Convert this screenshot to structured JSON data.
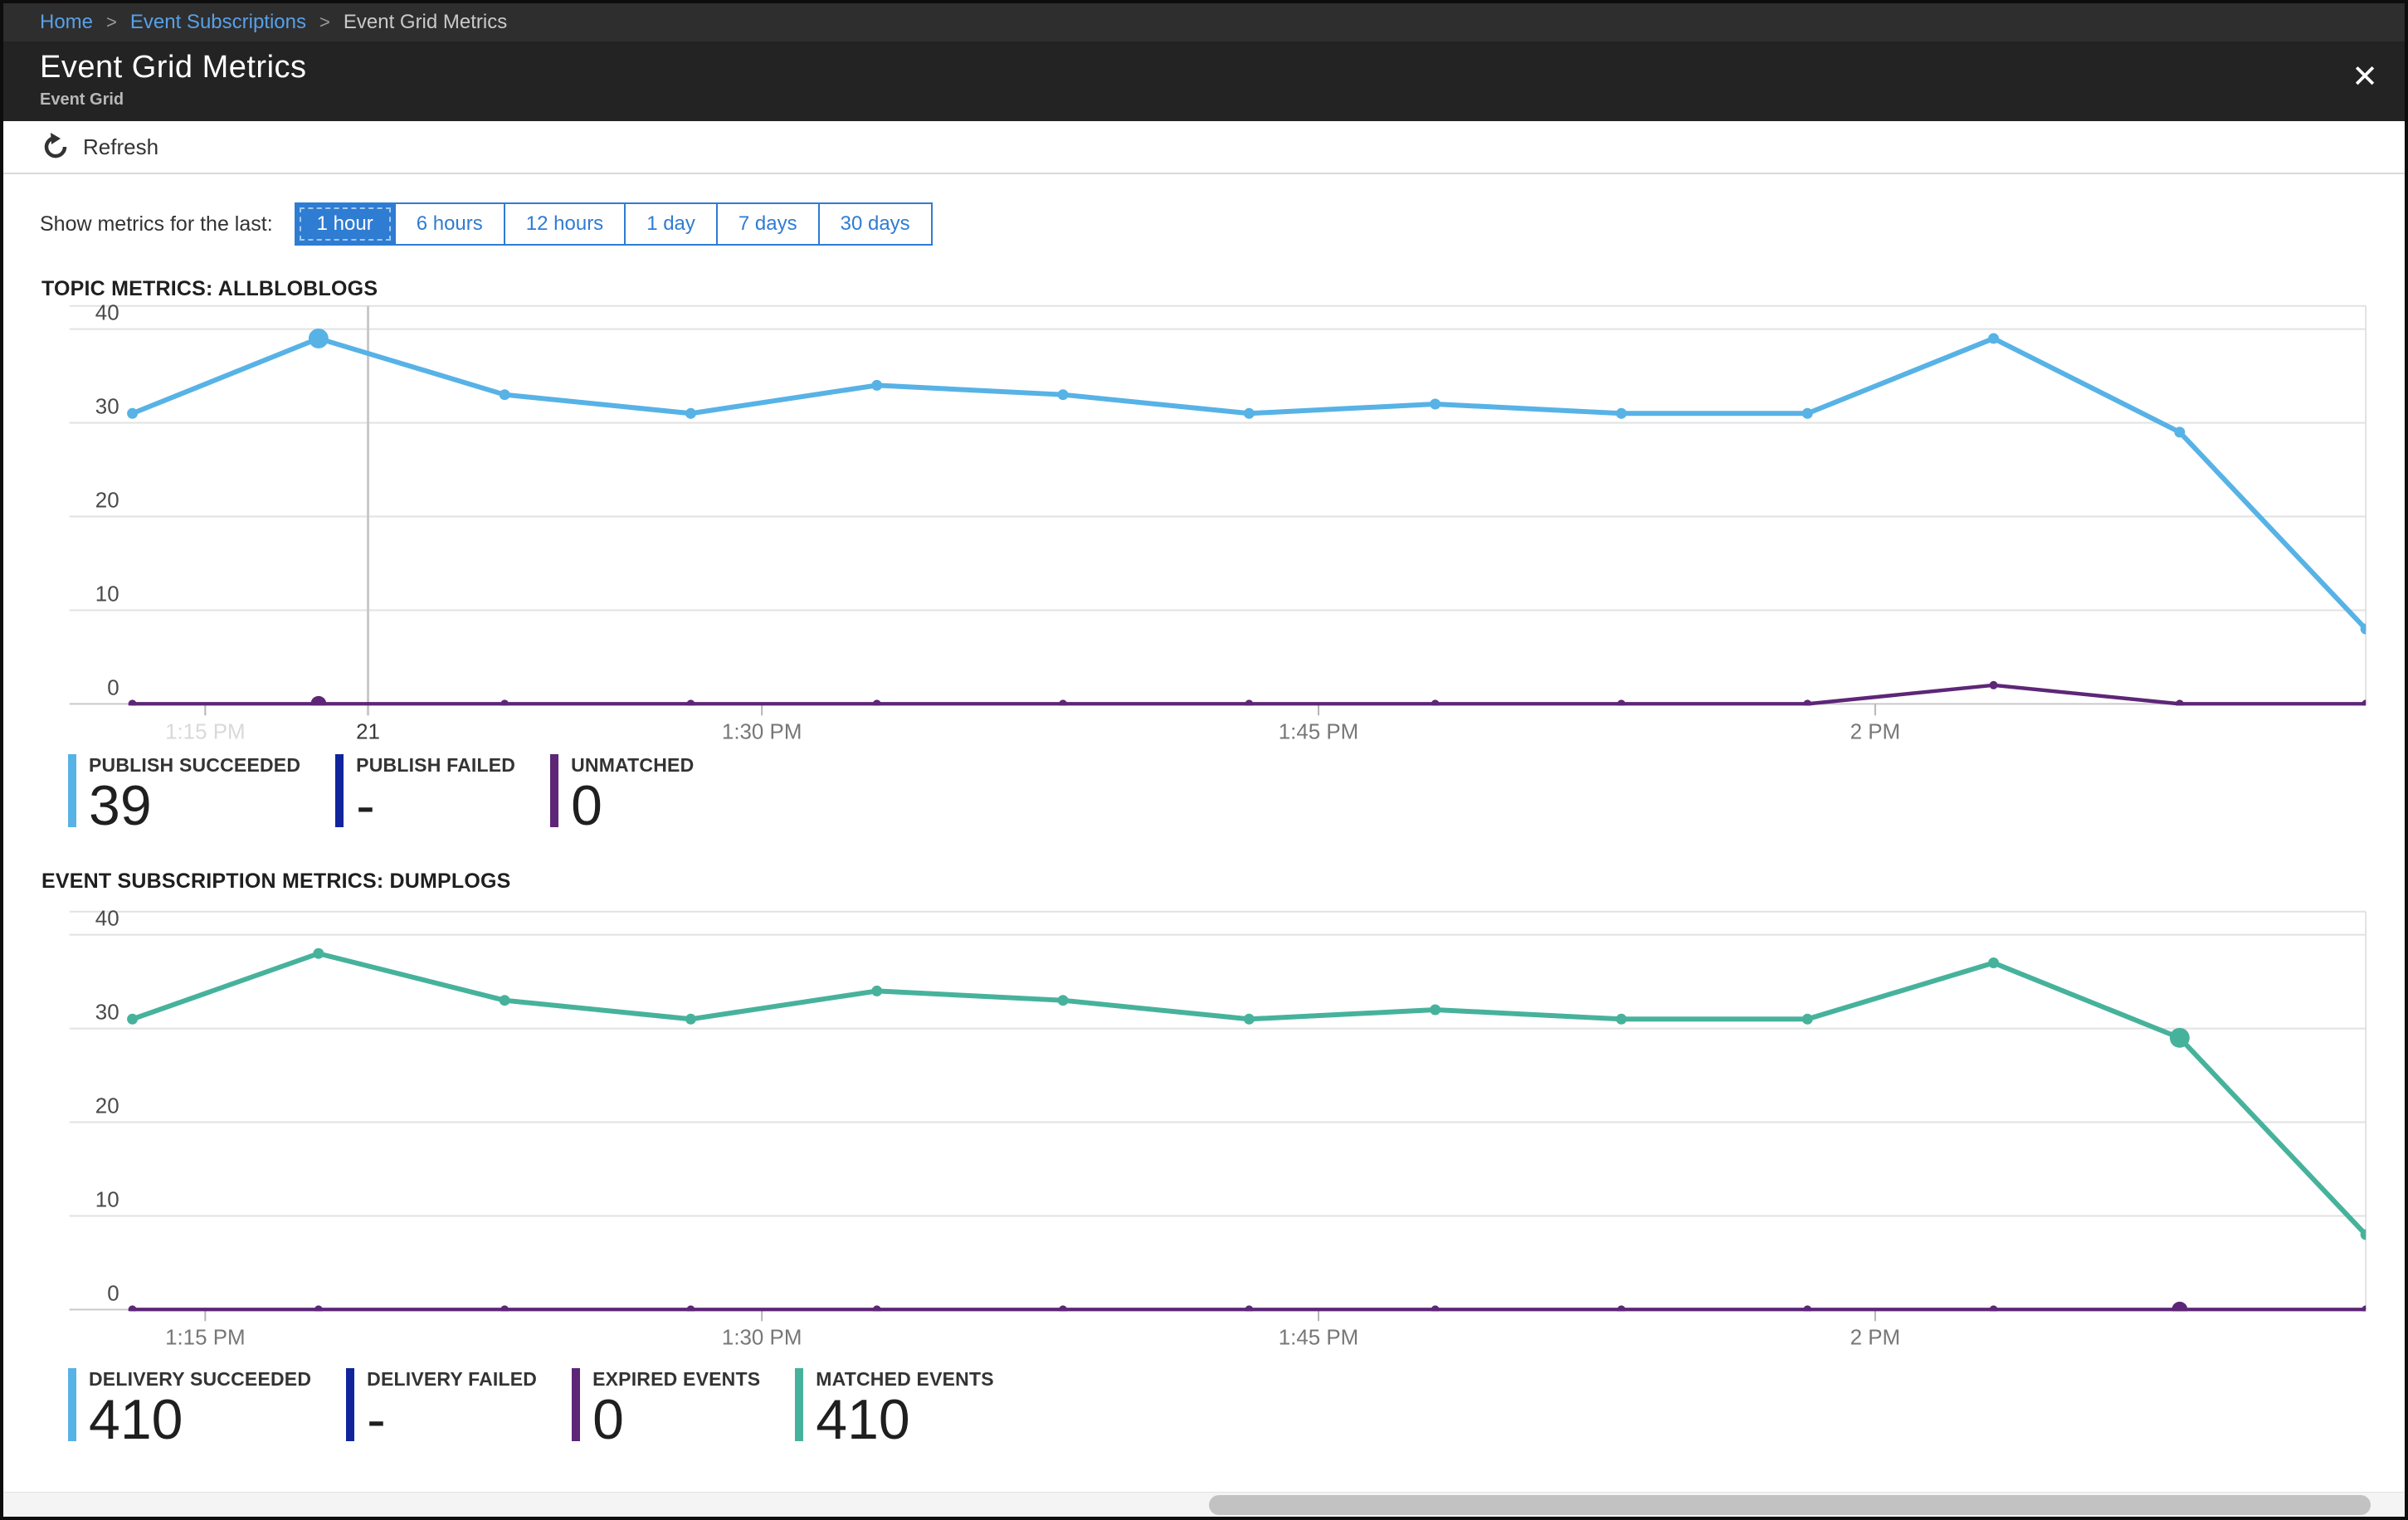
{
  "breadcrumb": {
    "separator": ">",
    "items": [
      {
        "label": "Home",
        "link": true
      },
      {
        "label": "Event Subscriptions",
        "link": true
      },
      {
        "label": "Event Grid Metrics",
        "link": false
      }
    ]
  },
  "header": {
    "title": "Event Grid Metrics",
    "subtitle": "Event Grid",
    "close_icon": "✕"
  },
  "toolbar": {
    "refresh_label": "Refresh"
  },
  "time_range": {
    "label": "Show metrics for the last:",
    "options": [
      "1 hour",
      "6 hours",
      "12 hours",
      "1 day",
      "7 days",
      "30 days"
    ],
    "selected": "1 hour"
  },
  "colors": {
    "accent": "#2f7cd3",
    "blue": "#57b2e6",
    "navy": "#10259c",
    "purple": "#5d2677",
    "green": "#47b29c",
    "grid": "#e2e2e2",
    "axis": "#c9c9c9",
    "tick": "#b5b5b5",
    "y_label": "#4a4a4a",
    "x_label": "#777777",
    "x_label_faded": "#d9d9d9",
    "crosshair": "#c9c9c9",
    "crosshair_label": "#3a3a3a"
  },
  "chart_data": [
    {
      "type": "line",
      "title": "TOPIC METRICS: ALLBLOBLOGS",
      "y_ticks": [
        0,
        10,
        20,
        30,
        40
      ],
      "ylim": [
        0,
        40
      ],
      "grid": true,
      "x_labels": [
        {
          "text": "1:15 PM",
          "faded": true
        },
        {
          "text": "1:30 PM",
          "faded": false
        },
        {
          "text": "1:45 PM",
          "faded": false
        },
        {
          "text": "2 PM",
          "faded": false
        }
      ],
      "crosshair": {
        "label": "21",
        "x_fraction": 0.13
      },
      "series": [
        {
          "name": "PUBLISH SUCCEEDED",
          "color": "blue",
          "values": [
            31,
            39,
            33,
            31,
            34,
            33,
            31,
            32,
            31,
            31,
            39,
            29,
            8
          ],
          "selected_index": 1
        },
        {
          "name": "UNMATCHED",
          "color": "purple",
          "values": [
            0,
            0,
            0,
            0,
            0,
            0,
            0,
            0,
            0,
            0,
            2,
            0,
            0
          ],
          "selected_index": 1
        }
      ],
      "legend": [
        {
          "label": "PUBLISH SUCCEEDED",
          "value": "39",
          "color": "blue"
        },
        {
          "label": "PUBLISH FAILED",
          "value": "-",
          "color": "navy"
        },
        {
          "label": "UNMATCHED",
          "value": "0",
          "color": "purple"
        }
      ]
    },
    {
      "type": "line",
      "title": "EVENT SUBSCRIPTION METRICS: DUMPLOGS",
      "y_ticks": [
        0,
        10,
        20,
        30,
        40
      ],
      "ylim": [
        0,
        40
      ],
      "grid": true,
      "x_labels": [
        {
          "text": "1:15 PM",
          "faded": false
        },
        {
          "text": "1:30 PM",
          "faded": false
        },
        {
          "text": "1:45 PM",
          "faded": false
        },
        {
          "text": "2 PM",
          "faded": false
        }
      ],
      "crosshair": null,
      "series": [
        {
          "name": "MATCHED EVENTS",
          "color": "green",
          "values": [
            31,
            38,
            33,
            31,
            34,
            33,
            31,
            32,
            31,
            31,
            37,
            29,
            8
          ],
          "selected_index": 11
        },
        {
          "name": "EXPIRED EVENTS",
          "color": "purple",
          "values": [
            0,
            0,
            0,
            0,
            0,
            0,
            0,
            0,
            0,
            0,
            0,
            0,
            0
          ],
          "selected_index": 11
        }
      ],
      "legend": [
        {
          "label": "DELIVERY SUCCEEDED",
          "value": "410",
          "color": "blue"
        },
        {
          "label": "DELIVERY FAILED",
          "value": "-",
          "color": "navy"
        },
        {
          "label": "EXPIRED EVENTS",
          "value": "0",
          "color": "purple"
        },
        {
          "label": "MATCHED EVENTS",
          "value": "410",
          "color": "green"
        }
      ]
    }
  ]
}
